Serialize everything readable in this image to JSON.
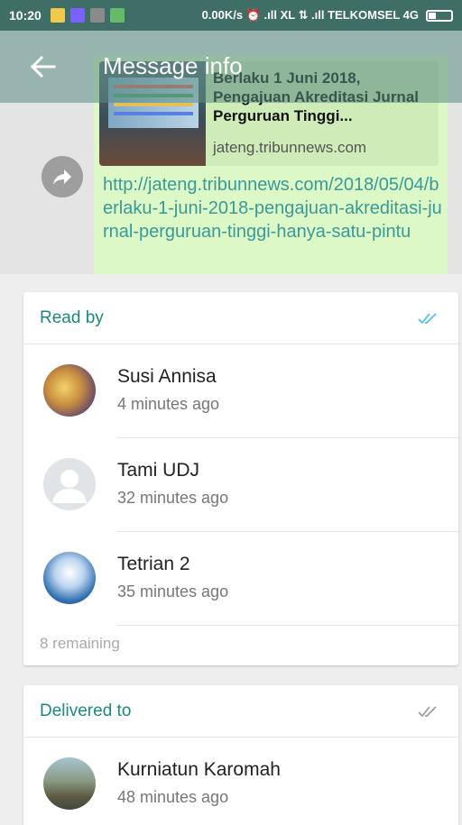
{
  "status_bar": {
    "time": "10:20",
    "right_text": "0.00K/s ⏰ .ıll XL ⇅ .ıll TELKOMSEL 4G"
  },
  "app_bar": {
    "title": "Message info"
  },
  "message": {
    "preview_title": "Berlaku 1 Juni 2018, Pengajuan Akreditasi Jurnal Perguruan Tinggi...",
    "preview_domain": "jateng.tribunnews.com",
    "link": "http://jateng.tribunnews.com/2018/05/04/berlaku-1-juni-2018-pengajuan-akreditasi-jurnal-perguruan-tinggi-hanya-satu-pintu"
  },
  "read_by": {
    "title": "Read by",
    "tick_color": "#4fc3f7",
    "contacts": [
      {
        "name": "Susi Annisa",
        "time": "4 minutes ago"
      },
      {
        "name": "Tami UDJ",
        "time": "32 minutes ago"
      },
      {
        "name": "Tetrian 2",
        "time": "35 minutes ago"
      }
    ],
    "remaining": "8 remaining"
  },
  "delivered_to": {
    "title": "Delivered to",
    "tick_color": "#9e9e9e",
    "contacts": [
      {
        "name": "Kurniatun Karomah",
        "time": "48 minutes ago"
      }
    ]
  },
  "colors": {
    "accent": "#1a8a7e",
    "bubble": "#dcf8c6",
    "link": "#3a9a9a"
  }
}
